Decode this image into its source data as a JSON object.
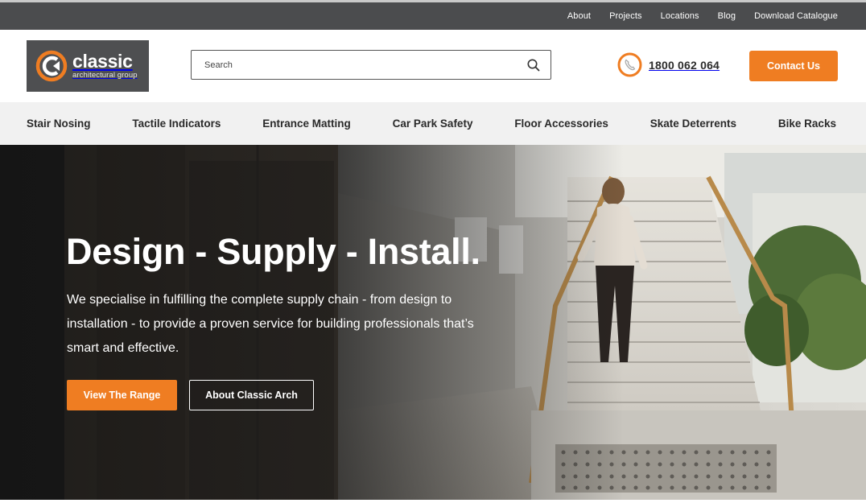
{
  "utility_nav": {
    "links": [
      "About",
      "Projects",
      "Locations",
      "Blog",
      "Download Catalogue"
    ]
  },
  "header": {
    "logo": {
      "name": "classic",
      "subtitle": "architectural group",
      "icon": "classic-logo-mark"
    },
    "search": {
      "placeholder": "Search",
      "value": "",
      "icon": "search-icon"
    },
    "phone": {
      "number": "1800 062 064",
      "icon": "phone-icon"
    },
    "contact_label": "Contact Us"
  },
  "category_nav": {
    "items": [
      "Stair Nosing",
      "Tactile Indicators",
      "Entrance Matting",
      "Car Park Safety",
      "Floor Accessories",
      "Skate Deterrents",
      "Bike Racks"
    ]
  },
  "hero": {
    "title": "Design - Supply - Install.",
    "body": "We specialise in fulfilling the complete supply chain - from design to installation - to provide a proven service for building professionals that’s smart and effective.",
    "primary_cta": "View The Range",
    "secondary_cta": "About Classic Arch"
  },
  "colors": {
    "accent": "#ef7d22",
    "utility_bar": "#4b4c4e",
    "logo_bg": "#4e4f51",
    "nav_bg": "#f1f1f1"
  }
}
